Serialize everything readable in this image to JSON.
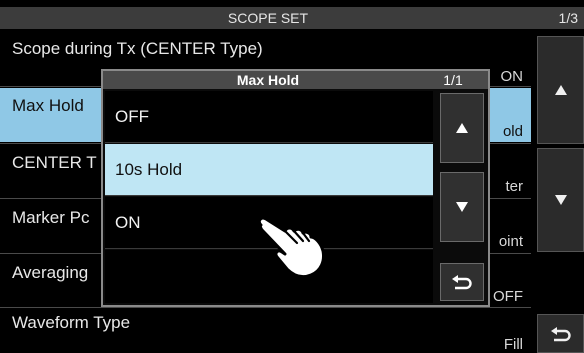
{
  "title_bar": {
    "title": "SCOPE SET",
    "page": "1/3"
  },
  "menu": {
    "items": [
      {
        "label": "Scope during Tx (CENTER Type)",
        "value": "ON"
      },
      {
        "label": "Max Hold",
        "value": "old"
      },
      {
        "label": "CENTER T",
        "value": "ter"
      },
      {
        "label": "Marker Pc",
        "value": "oint"
      },
      {
        "label": "Averaging",
        "value": "OFF"
      },
      {
        "label": "Waveform Type",
        "value": "Fill"
      }
    ]
  },
  "popup": {
    "title": "Max Hold",
    "page": "1/1",
    "options": [
      "OFF",
      "10s Hold",
      "ON"
    ],
    "selected": "10s Hold"
  },
  "icons": {
    "scroll_up": "triangle-up-icon",
    "scroll_down": "triangle-down-icon",
    "back": "return-arrow-icon",
    "touch": "pointing-hand-icon"
  },
  "colors": {
    "selected_row": "#8fc8e6",
    "selected_option": "#bfe6f4",
    "title_bar": "#3c3c3c"
  }
}
